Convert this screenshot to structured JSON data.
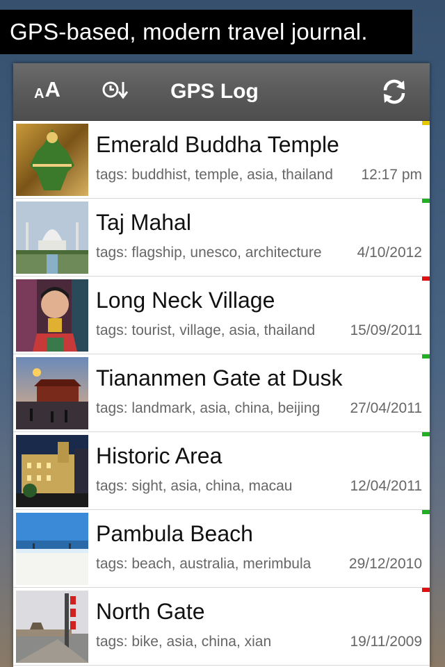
{
  "banner": {
    "text": "GPS-based, modern travel journal."
  },
  "navbar": {
    "font_small": "A",
    "font_big": "A",
    "title": "GPS Log",
    "icons": {
      "font": "font-size-icon",
      "sort": "clock-sort-icon",
      "refresh": "refresh-icon"
    }
  },
  "entries": [
    {
      "title": "Emerald Buddha Temple",
      "tags": "tags: buddhist, temple, asia, thailand",
      "date": "12:17 pm",
      "flag_color": "#e6c800",
      "thumb": "temple"
    },
    {
      "title": "Taj Mahal",
      "tags": "tags: flagship, unesco, architecture",
      "date": "4/10/2012",
      "flag_color": "#22b022",
      "thumb": "taj"
    },
    {
      "title": "Long Neck Village",
      "tags": "tags: tourist, village, asia, thailand",
      "date": "15/09/2011",
      "flag_color": "#e01010",
      "thumb": "village"
    },
    {
      "title": "Tiananmen Gate at Dusk",
      "tags": "tags: landmark, asia, china, beijing",
      "date": "27/04/2011",
      "flag_color": "#22b022",
      "thumb": "tiananmen"
    },
    {
      "title": "Historic Area",
      "tags": "tags: sight, asia, china, macau",
      "date": "12/04/2011",
      "flag_color": "#22b022",
      "thumb": "historic"
    },
    {
      "title": "Pambula Beach",
      "tags": "tags: beach, australia, merimbula",
      "date": "29/12/2010",
      "flag_color": "#22b022",
      "thumb": "beach"
    },
    {
      "title": "North Gate",
      "tags": "tags: bike, asia, china, xian",
      "date": "19/11/2009",
      "flag_color": "#e01010",
      "thumb": "northgate"
    }
  ]
}
